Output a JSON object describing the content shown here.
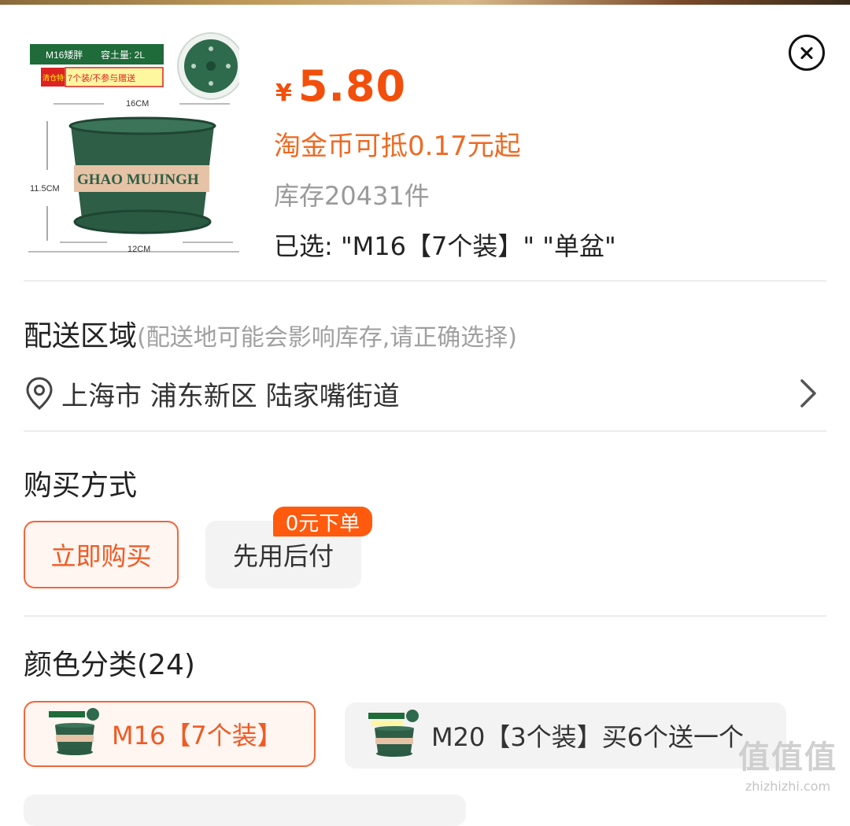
{
  "product": {
    "thumbnail": {
      "model_label": "M16矮胖",
      "capacity_label": "容土量: 2L",
      "promo_tag": "清仓特价",
      "promo_text": "7个装/不参与赠送",
      "top_width": "16CM",
      "height": "11.5CM",
      "bottom_width": "12CM",
      "brand_text": "GHAO MUJINGH"
    },
    "currency": "¥",
    "price": "5.80",
    "coin_offer": "淘金币可抵0.17元起",
    "stock": "库存20431件",
    "selected": "已选: \"M16【7个装】\" \"单盆\""
  },
  "delivery": {
    "title": "配送区域",
    "hint": "(配送地可能会影响库存,请正确选择)",
    "address": "上海市 浦东新区 陆家嘴街道"
  },
  "purchase": {
    "title": "购买方式",
    "buy_now": "立即购买",
    "pay_later": "先用后付",
    "pay_later_badge": "0元下单"
  },
  "color": {
    "title": "颜色分类(24)",
    "options": [
      {
        "label": "M16【7个装】",
        "selected": true
      },
      {
        "label": "M20【3个装】买6个送一个",
        "selected": false
      }
    ]
  },
  "watermark": {
    "glyph": "值值值",
    "url": "zhizhizhi.com"
  },
  "colors": {
    "accent": "#f24f0c",
    "accent_light": "#fff5f1",
    "pot_green": "#2e5e46",
    "neutral_chip": "#f3f3f3"
  }
}
